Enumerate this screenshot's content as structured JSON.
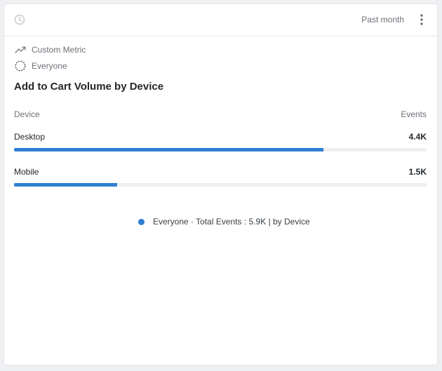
{
  "header": {
    "icon": "clock-icon",
    "range_label": "Past month",
    "menu_icon": "kebab-menu-icon"
  },
  "meta": {
    "metric_label": "Custom Metric",
    "metric_icon": "trend-line-icon",
    "segment_label": "Everyone",
    "segment_icon": "segment-ring-icon"
  },
  "title": "Add to Cart Volume by Device",
  "table": {
    "col_left": "Device",
    "col_right": "Events",
    "rows": [
      {
        "label": "Desktop",
        "value": "4.4K",
        "fill": 0.75
      },
      {
        "label": "Mobile",
        "value": "1.5K",
        "fill": 0.25
      }
    ]
  },
  "legend": {
    "text": "Everyone · Total Events : 5.9K | by Device",
    "color": "#2f7fd0"
  }
}
